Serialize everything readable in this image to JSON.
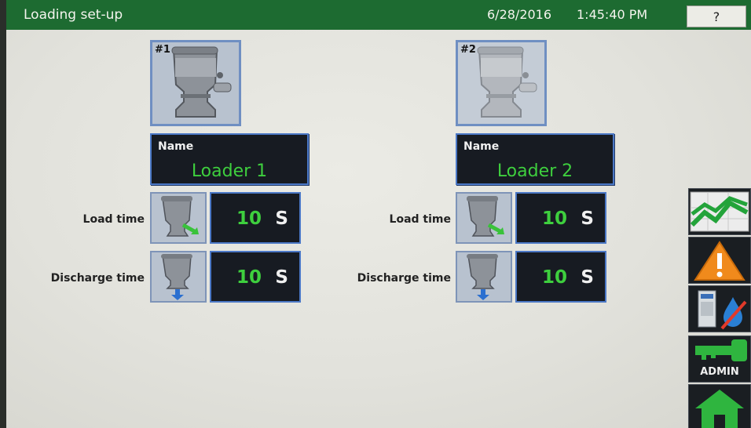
{
  "header": {
    "title": "Loading set-up",
    "date": "6/28/2016",
    "time": "1:45:40 PM",
    "help_label": "?"
  },
  "loaders": [
    {
      "number": "#1",
      "name_label": "Name",
      "name": "Loader 1",
      "load_time_label": "Load time",
      "load_time_value": "10",
      "load_time_unit": "S",
      "discharge_time_label": "Discharge time",
      "discharge_time_value": "10",
      "discharge_time_unit": "S"
    },
    {
      "number": "#2",
      "name_label": "Name",
      "name": "Loader 2",
      "load_time_label": "Load time",
      "load_time_value": "10",
      "load_time_unit": "S",
      "discharge_time_label": "Discharge time",
      "discharge_time_value": "10",
      "discharge_time_unit": "S"
    }
  ],
  "sidebar": {
    "items": [
      {
        "icon": "trend-chart-icon"
      },
      {
        "icon": "alarm-warning-icon"
      },
      {
        "icon": "dryer-no-water-icon"
      },
      {
        "icon": "key-icon",
        "label": "ADMIN"
      },
      {
        "icon": "home-icon"
      }
    ]
  },
  "colors": {
    "title_bar": "#1d6b31",
    "value_text": "#3ecf3e",
    "field_background": "#171b22",
    "field_border": "#4b78c6",
    "warning": "#f08a1c"
  }
}
